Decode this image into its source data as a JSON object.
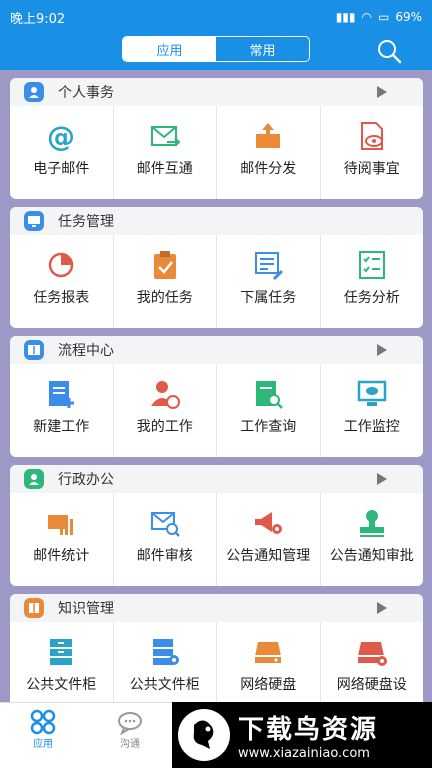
{
  "status": {
    "time": "晚上9:02",
    "battery": "69%"
  },
  "header": {
    "segment_active": "应用",
    "segment_inactive": "常用"
  },
  "sections": [
    {
      "title": "个人事务",
      "items": [
        "电子邮件",
        "邮件互通",
        "邮件分发",
        "待阅事宜"
      ]
    },
    {
      "title": "任务管理",
      "items": [
        "任务报表",
        "我的任务",
        "下属任务",
        "任务分析"
      ]
    },
    {
      "title": "流程中心",
      "items": [
        "新建工作",
        "我的工作",
        "工作查询",
        "工作监控"
      ]
    },
    {
      "title": "行政办公",
      "items": [
        "邮件统计",
        "邮件审核",
        "公告通知管理",
        "公告通知审批"
      ]
    },
    {
      "title": "知识管理",
      "items": [
        "公共文件柜",
        "公共文件柜",
        "网络硬盘",
        "网络硬盘设"
      ]
    }
  ],
  "tabbar": {
    "tab1": "应用",
    "tab2": "沟通"
  },
  "watermark": {
    "title": "下载鸟资源",
    "url": "www.xiazainiao.com"
  },
  "colors": {
    "primary": "#1a8fe6",
    "background": "#9d99c6"
  }
}
